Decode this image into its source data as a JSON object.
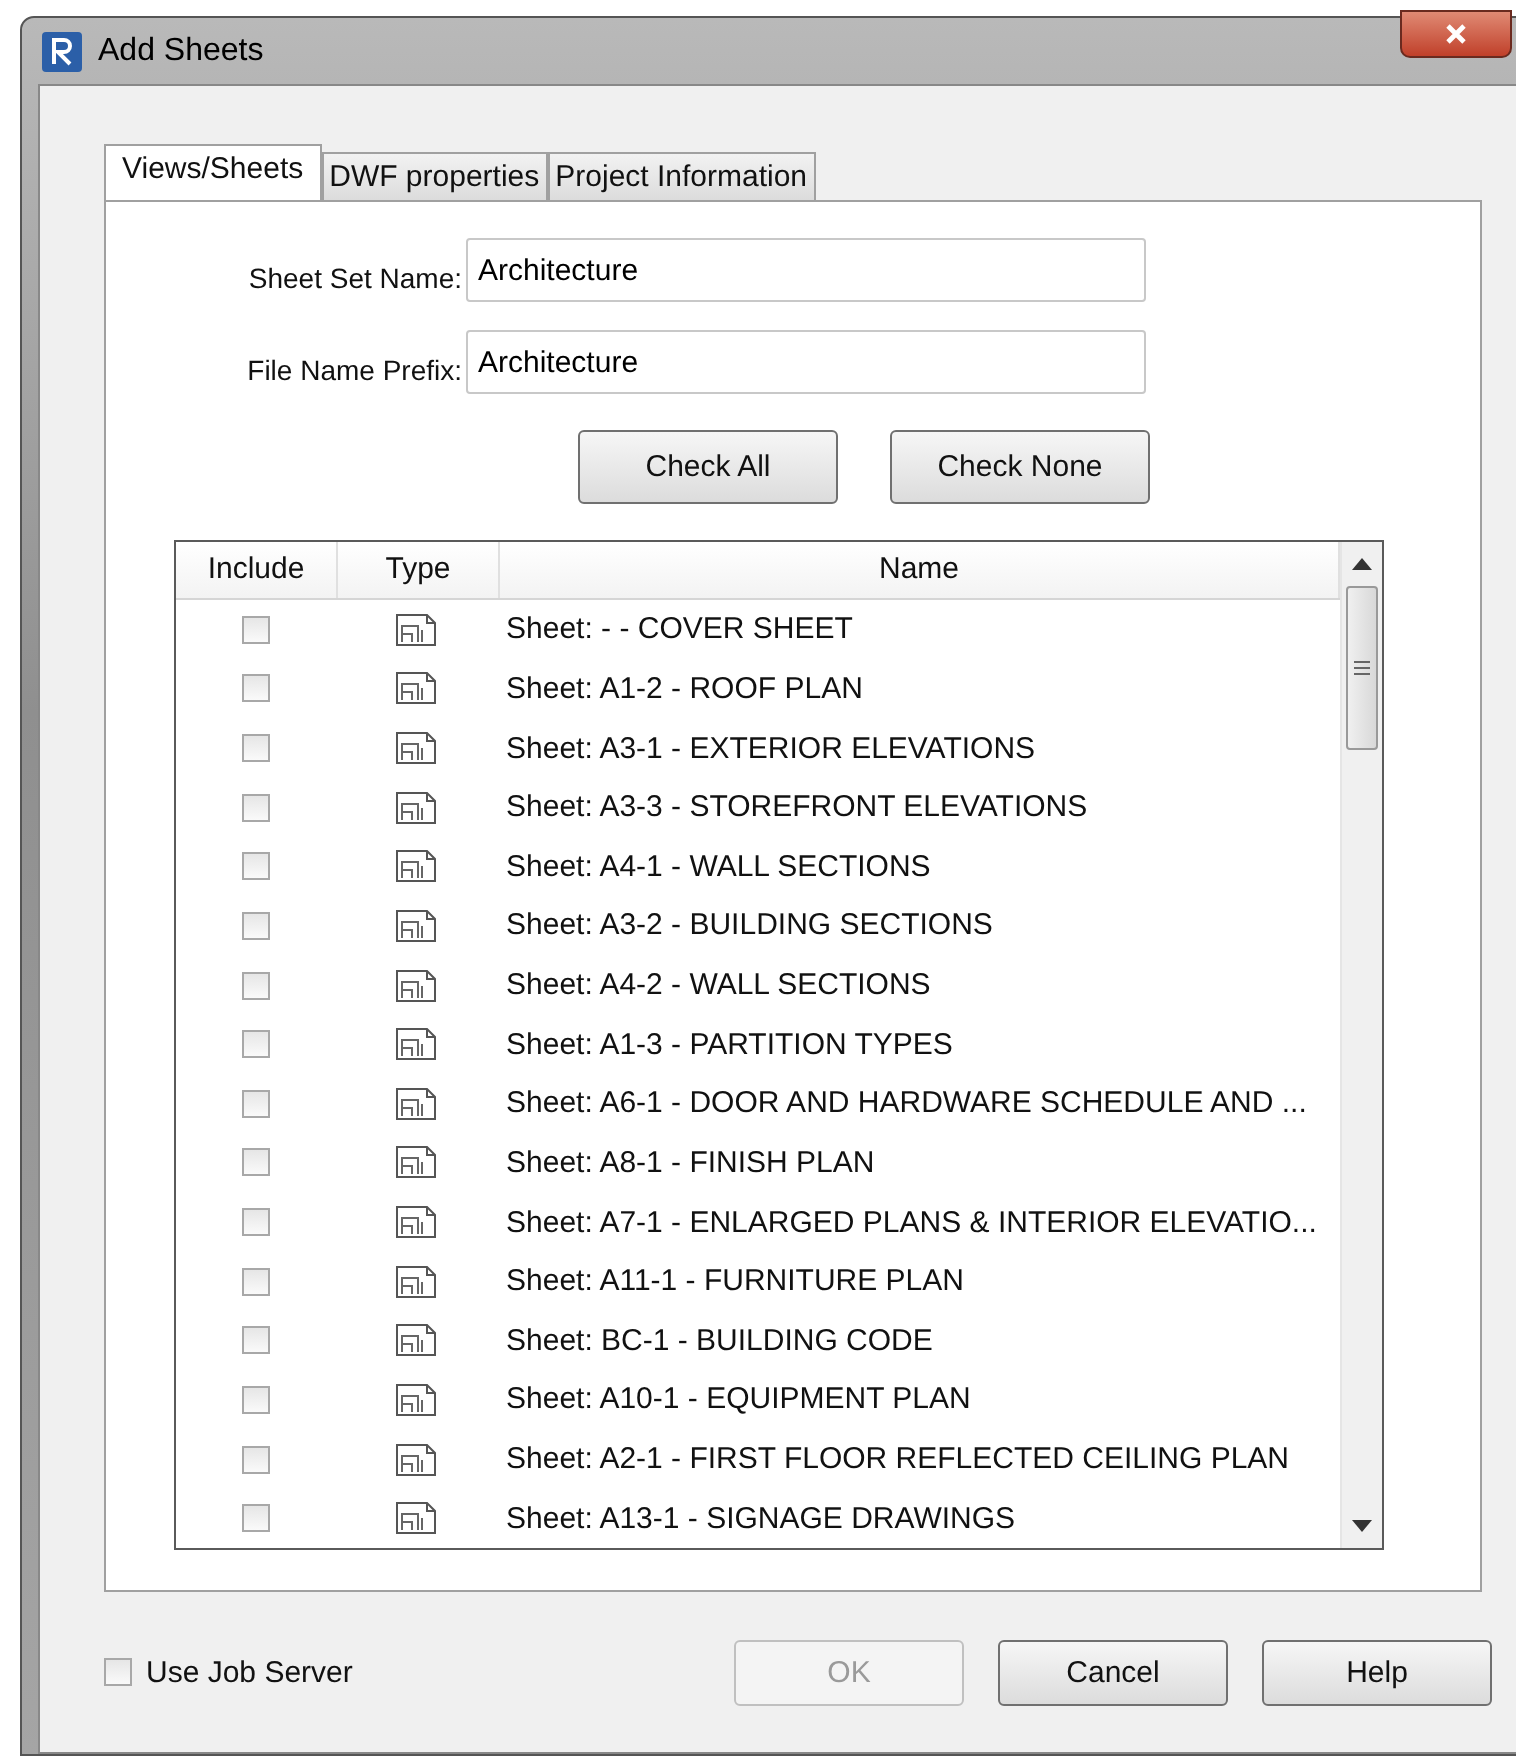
{
  "window": {
    "title": "Add Sheets"
  },
  "tabs": [
    {
      "label": "Views/Sheets",
      "selected": true
    },
    {
      "label": "DWF properties",
      "selected": false
    },
    {
      "label": "Project Information",
      "selected": false
    }
  ],
  "fields": [
    {
      "label": "Sheet Set Name:",
      "value": "Architecture"
    },
    {
      "label": "File Name Prefix:",
      "value": "Architecture"
    }
  ],
  "check_buttons": [
    "Check All",
    "Check None"
  ],
  "table": {
    "columns": [
      "Include",
      "Type",
      "Name"
    ],
    "rows": [
      {
        "checked": false,
        "name": "Sheet: - - COVER SHEET"
      },
      {
        "checked": false,
        "name": "Sheet: A1-2 - ROOF PLAN"
      },
      {
        "checked": false,
        "name": "Sheet: A3-1 - EXTERIOR ELEVATIONS"
      },
      {
        "checked": false,
        "name": "Sheet: A3-3 - STOREFRONT ELEVATIONS"
      },
      {
        "checked": false,
        "name": "Sheet: A4-1 - WALL SECTIONS"
      },
      {
        "checked": false,
        "name": "Sheet: A3-2 - BUILDING SECTIONS"
      },
      {
        "checked": false,
        "name": "Sheet: A4-2 - WALL SECTIONS"
      },
      {
        "checked": false,
        "name": "Sheet: A1-3 - PARTITION TYPES"
      },
      {
        "checked": false,
        "name": "Sheet: A6-1 - DOOR AND HARDWARE SCHEDULE AND ..."
      },
      {
        "checked": false,
        "name": "Sheet: A8-1 - FINISH PLAN"
      },
      {
        "checked": false,
        "name": "Sheet: A7-1 - ENLARGED PLANS & INTERIOR ELEVATIO..."
      },
      {
        "checked": false,
        "name": "Sheet: A11-1 - FURNITURE PLAN"
      },
      {
        "checked": false,
        "name": "Sheet: BC-1 - BUILDING CODE"
      },
      {
        "checked": false,
        "name": "Sheet: A10-1 - EQUIPMENT PLAN"
      },
      {
        "checked": false,
        "name": "Sheet: A2-1 - FIRST FLOOR REFLECTED CEILING PLAN"
      },
      {
        "checked": false,
        "name": "Sheet: A13-1 - SIGNAGE DRAWINGS"
      }
    ]
  },
  "use_job_server": {
    "label": "Use Job Server",
    "checked": false
  },
  "buttons": [
    {
      "label": "OK",
      "disabled": true
    },
    {
      "label": "Cancel",
      "disabled": false
    },
    {
      "label": "Help",
      "disabled": false
    }
  ]
}
